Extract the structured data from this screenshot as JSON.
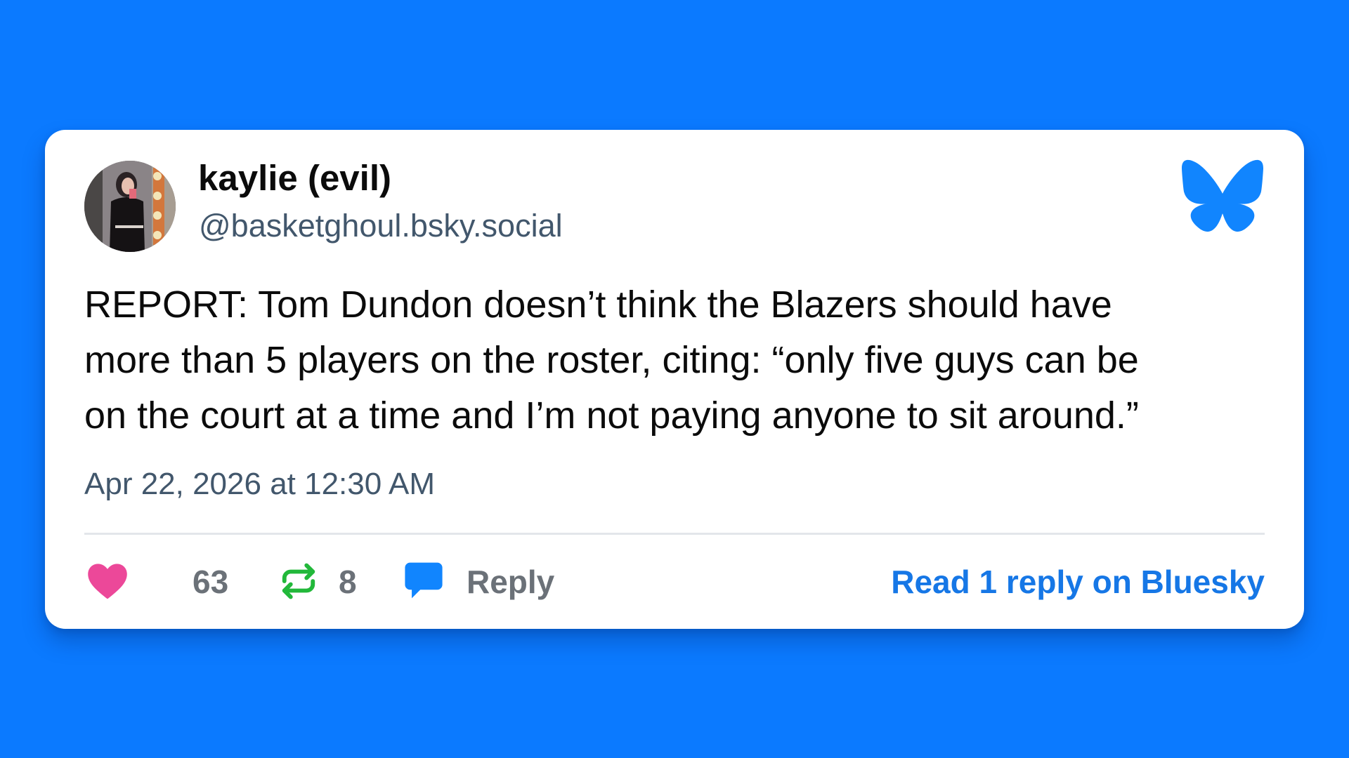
{
  "author": {
    "display_name": "kaylie (evil)",
    "handle": "@basketghoul.bsky.social"
  },
  "post": {
    "text_lines": [
      "REPORT: Tom Dundon doesn’t think the Blazers should have",
      "more than 5 players on the roster, citing: “only five guys can be",
      "on the court at a time and I’m not paying anyone to sit around.”"
    ],
    "timestamp": "Apr 22, 2026 at 12:30 AM"
  },
  "actions": {
    "like_count": "63",
    "repost_count": "8",
    "reply_label": "Reply",
    "read_replies_label": "Read 1 reply on Bluesky"
  },
  "icons": {
    "logo": "bluesky-butterfly-icon",
    "like": "heart-icon",
    "repost": "repost-icon",
    "reply": "speech-bubble-icon"
  },
  "colors": {
    "background": "#0b7aff",
    "card": "#ffffff",
    "text": "#0b0b0b",
    "muted": "#42576c",
    "heart": "#ec4899",
    "repost": "#22b83a",
    "brand": "#1677e6"
  }
}
